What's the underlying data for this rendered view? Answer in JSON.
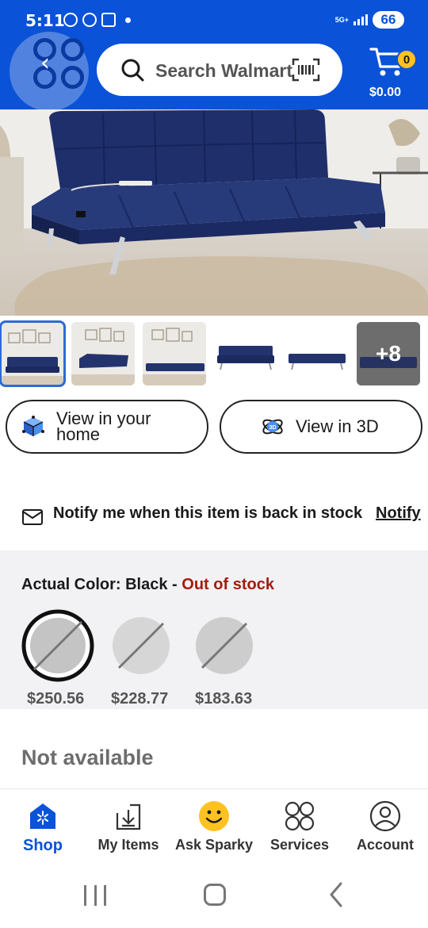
{
  "status_bar": {
    "time": "5:11",
    "network": "5G+",
    "battery": "66"
  },
  "header": {
    "search_placeholder": "Search Walmart",
    "cart_count": "0",
    "cart_total": "$0.00",
    "brand_color": "#0a52d8",
    "badge_color": "#ffc220"
  },
  "product": {
    "main_image": "navy-futon-sofa-photo",
    "thumbnails": [
      {
        "name": "thumb-1",
        "scene": "living-room",
        "selected": true
      },
      {
        "name": "thumb-2",
        "scene": "living-room-reclined"
      },
      {
        "name": "thumb-3",
        "scene": "living-room-flat"
      },
      {
        "name": "thumb-4",
        "scene": "product-sofa"
      },
      {
        "name": "thumb-5",
        "scene": "product-bed"
      },
      {
        "name": "thumb-6",
        "scene": "more",
        "label": "+8"
      }
    ]
  },
  "actions": {
    "view_home_line1": "View in your",
    "view_home_line2": "home",
    "view_3d": "View in 3D"
  },
  "notify": {
    "text": "Notify me when this item is back in stock",
    "link": "Notify"
  },
  "color": {
    "label_prefix": "Actual Color: Black - ",
    "status": "Out of stock",
    "status_color": "#a31c0e",
    "options": [
      {
        "price": "$250.56",
        "selected": true
      },
      {
        "price": "$228.77",
        "selected": false
      },
      {
        "price": "$183.63",
        "selected": false
      }
    ]
  },
  "availability": "Not available",
  "bottom_nav": [
    {
      "label": "Shop",
      "icon": "shop-icon",
      "active": true
    },
    {
      "label": "My Items",
      "icon": "my-items-icon",
      "active": false
    },
    {
      "label": "Ask Sparky",
      "icon": "sparky-icon",
      "active": false
    },
    {
      "label": "Services",
      "icon": "services-icon",
      "active": false
    },
    {
      "label": "Account",
      "icon": "account-icon",
      "active": false
    }
  ]
}
